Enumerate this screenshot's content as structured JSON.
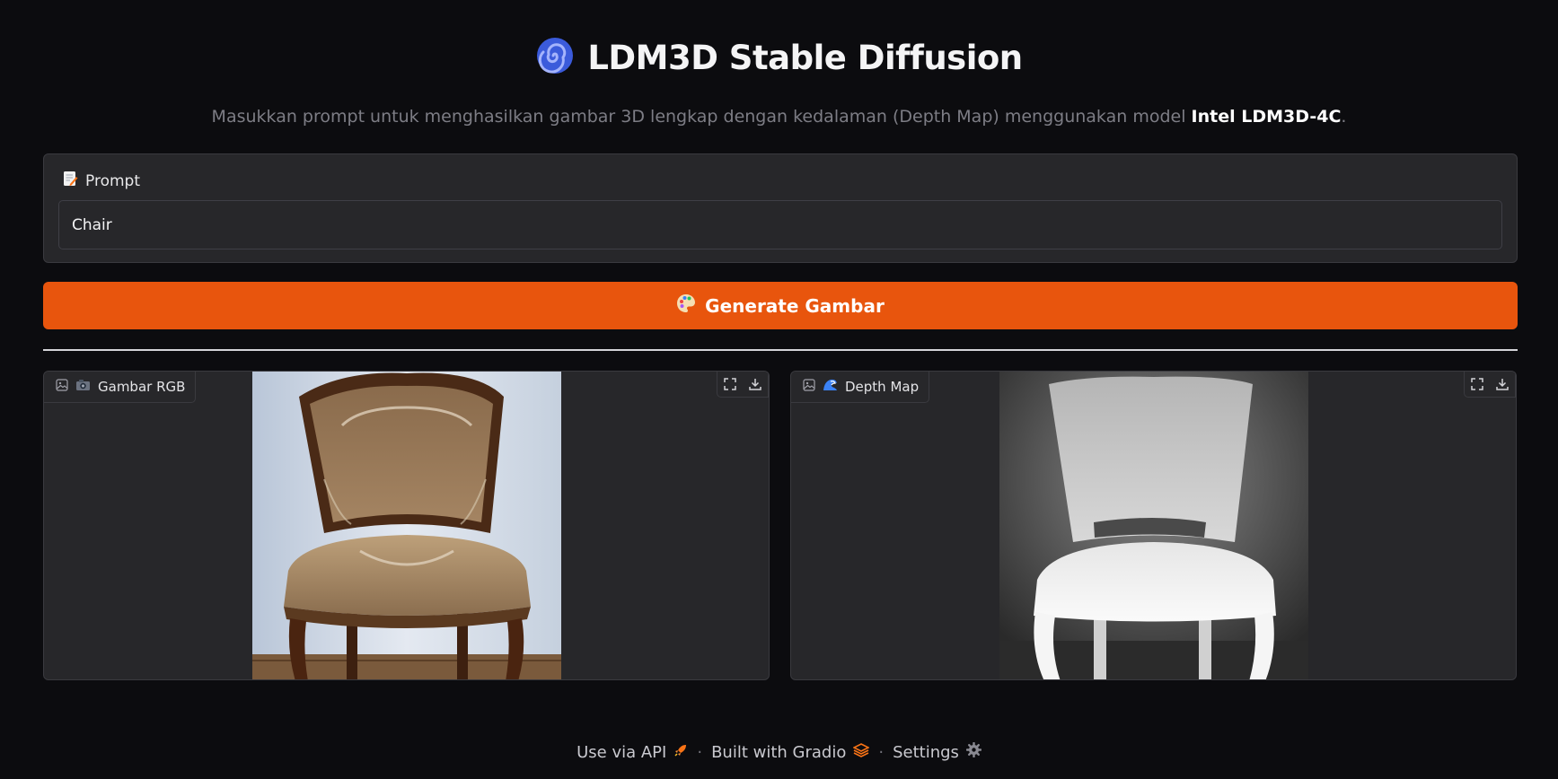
{
  "header": {
    "title": "LDM3D Stable Diffusion",
    "subtitle_text": "Masukkan prompt untuk menghasilkan gambar 3D lengkap dengan kedalaman (Depth Map) menggunakan model ",
    "subtitle_bold": "Intel LDM3D-4C",
    "subtitle_end": "."
  },
  "prompt": {
    "label": "Prompt",
    "value": "Chair",
    "icon": "memo-icon"
  },
  "generate_button": {
    "label": "Generate Gambar",
    "icon": "palette-icon",
    "color": "#e8550d"
  },
  "outputs": {
    "rgb": {
      "label": "Gambar RGB",
      "icon": "camera-icon"
    },
    "depth": {
      "label": "Depth Map",
      "icon": "wave-icon"
    }
  },
  "footer": {
    "api": "Use via API",
    "built": "Built with Gradio",
    "settings": "Settings",
    "separator": "·"
  }
}
